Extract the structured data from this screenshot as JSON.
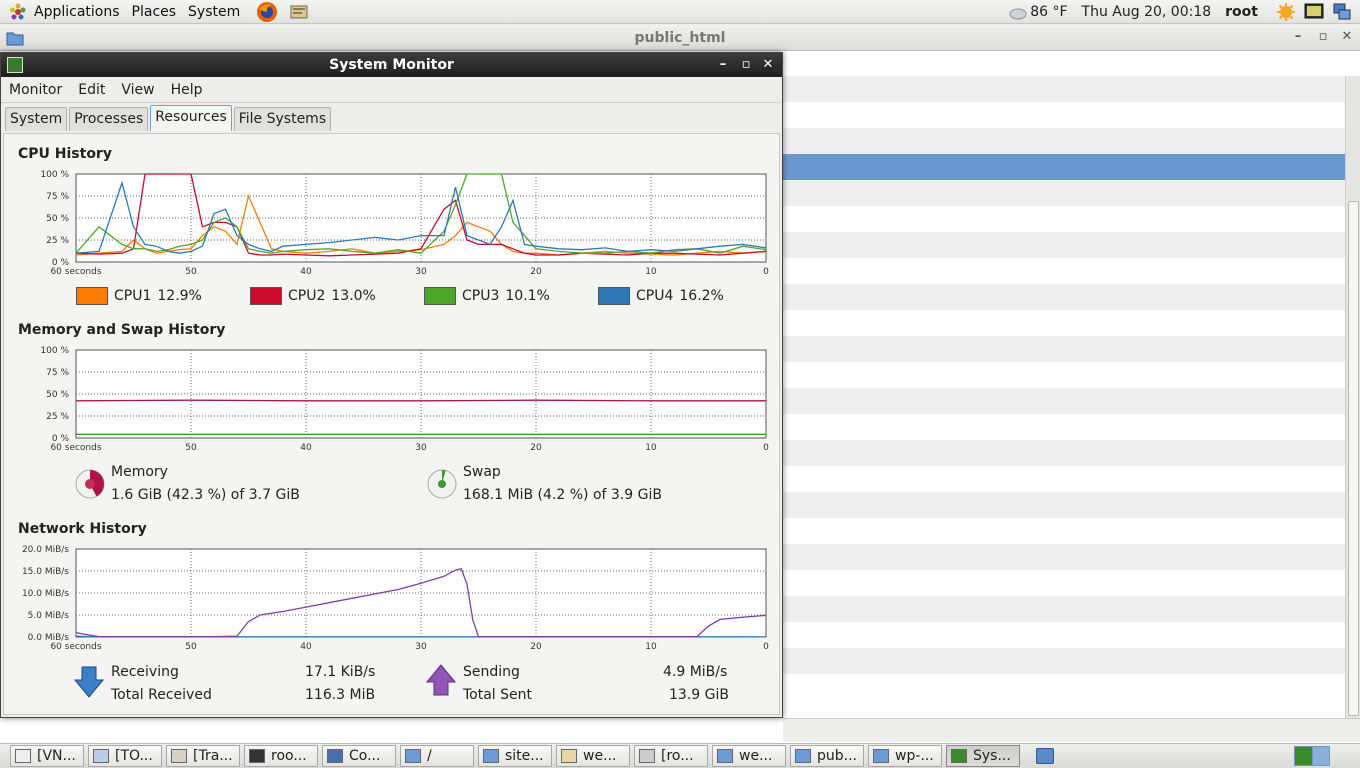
{
  "top_panel": {
    "menus": [
      "Applications",
      "Places",
      "System"
    ],
    "weather": "86 °F",
    "clock": "Thu Aug 20, 00:18",
    "user": "root"
  },
  "bg_window": {
    "title": "public_html",
    "ctrl_min": "–",
    "ctrl_max": "▫",
    "ctrl_close": "✕"
  },
  "sm_window": {
    "title": "System Monitor",
    "ctrl_min": "–",
    "ctrl_max": "▫",
    "ctrl_close": "✕",
    "menus": [
      "Monitor",
      "Edit",
      "View",
      "Help"
    ],
    "tabs": [
      "System",
      "Processes",
      "Resources",
      "File Systems"
    ],
    "active_tab": "Resources"
  },
  "cpu": {
    "title": "CPU History",
    "y_ticks": [
      "100 %",
      "75 %",
      "50 %",
      "25 %",
      "0 %"
    ],
    "x_ticks": [
      "60 seconds",
      "50",
      "40",
      "30",
      "20",
      "10",
      "0"
    ],
    "legend": [
      {
        "name": "CPU1",
        "value": "12.9%",
        "color": "#ff7b00"
      },
      {
        "name": "CPU2",
        "value": "13.0%",
        "color": "#cc0a2e"
      },
      {
        "name": "CPU3",
        "value": "10.1%",
        "color": "#4ea72a"
      },
      {
        "name": "CPU4",
        "value": "16.2%",
        "color": "#2f78b8"
      }
    ]
  },
  "memory": {
    "title": "Memory and Swap History",
    "y_ticks": [
      "100 %",
      "75 %",
      "50 %",
      "25 %",
      "0 %"
    ],
    "x_ticks": [
      "60 seconds",
      "50",
      "40",
      "30",
      "20",
      "10",
      "0"
    ],
    "memory_label": "Memory",
    "memory_value": "1.6 GiB (42.3 %) of 3.7 GiB",
    "memory_color": "#b0124a",
    "swap_label": "Swap",
    "swap_value": "168.1 MiB (4.2 %) of 3.9 GiB",
    "swap_color": "#3f9a2b"
  },
  "network": {
    "title": "Network History",
    "y_ticks": [
      "20.0 MiB/s",
      "15.0 MiB/s",
      "10.0 MiB/s",
      "5.0 MiB/s",
      "0.0 MiB/s"
    ],
    "x_ticks": [
      "60 seconds",
      "50",
      "40",
      "30",
      "20",
      "10",
      "0"
    ],
    "receiving_label": "Receiving",
    "receiving_value": "17.1 KiB/s",
    "total_received_label": "Total Received",
    "total_received_value": "116.3 MiB",
    "sending_label": "Sending",
    "sending_value": "4.9 MiB/s",
    "total_sent_label": "Total Sent",
    "total_sent_value": "13.9 GiB",
    "receive_color": "#2f78b8",
    "send_color": "#7d3fa6"
  },
  "chart_data": [
    {
      "type": "line",
      "title": "CPU History",
      "x": [
        60,
        58,
        56,
        55,
        54,
        53,
        52,
        51,
        50,
        49,
        48,
        47,
        46,
        45,
        44,
        43,
        42,
        40,
        38,
        36,
        34,
        32,
        30,
        28,
        27,
        26,
        25,
        24,
        23,
        22,
        21,
        20,
        18,
        16,
        14,
        12,
        10,
        8,
        6,
        4,
        2,
        0
      ],
      "ylim": [
        0,
        100
      ],
      "series": [
        {
          "name": "CPU1",
          "values": [
            8,
            10,
            12,
            25,
            15,
            10,
            12,
            14,
            15,
            30,
            40,
            35,
            20,
            75,
            45,
            15,
            12,
            10,
            12,
            15,
            10,
            12,
            14,
            20,
            30,
            45,
            40,
            35,
            20,
            12,
            10,
            10,
            8,
            10,
            12,
            10,
            9,
            8,
            10,
            12,
            10,
            12
          ]
        },
        {
          "name": "CPU2",
          "values": [
            10,
            9,
            10,
            15,
            100,
            100,
            100,
            100,
            100,
            40,
            45,
            45,
            40,
            10,
            8,
            8,
            9,
            8,
            7,
            8,
            9,
            10,
            15,
            60,
            70,
            25,
            20,
            20,
            20,
            15,
            10,
            8,
            8,
            10,
            9,
            8,
            10,
            10,
            9,
            8,
            10,
            12
          ]
        },
        {
          "name": "CPU3",
          "values": [
            10,
            40,
            20,
            15,
            15,
            12,
            14,
            18,
            20,
            25,
            45,
            50,
            40,
            15,
            12,
            10,
            12,
            14,
            15,
            12,
            10,
            14,
            10,
            35,
            65,
            100,
            100,
            100,
            100,
            45,
            30,
            15,
            12,
            10,
            10,
            12,
            10,
            14,
            15,
            10,
            18,
            14
          ]
        },
        {
          "name": "CPU4",
          "values": [
            10,
            12,
            90,
            40,
            20,
            18,
            12,
            10,
            12,
            18,
            55,
            60,
            30,
            20,
            15,
            12,
            18,
            20,
            22,
            25,
            28,
            25,
            30,
            30,
            85,
            30,
            25,
            20,
            40,
            70,
            20,
            18,
            15,
            14,
            16,
            12,
            14,
            12,
            15,
            18,
            20,
            16
          ]
        }
      ]
    },
    {
      "type": "line",
      "title": "Memory and Swap History",
      "x": [
        60,
        50,
        40,
        30,
        20,
        10,
        0
      ],
      "ylim": [
        0,
        100
      ],
      "series": [
        {
          "name": "Memory",
          "values": [
            42.3,
            43,
            42.3,
            42.3,
            43,
            42.3,
            42.3
          ]
        },
        {
          "name": "Swap",
          "values": [
            4.2,
            4.2,
            4.2,
            4.2,
            4.2,
            4.2,
            4.2
          ]
        }
      ]
    },
    {
      "type": "line",
      "title": "Network History",
      "x": [
        60,
        59,
        58,
        50,
        48,
        46,
        45,
        44,
        42,
        40,
        38,
        36,
        34,
        32,
        30,
        28,
        27,
        26.5,
        26,
        25.5,
        25,
        20,
        15,
        10,
        6,
        5,
        4,
        2,
        0
      ],
      "ylim": [
        0,
        20
      ],
      "series": [
        {
          "name": "Receiving",
          "values": [
            0.2,
            0.1,
            0.05,
            0.05,
            0.05,
            0.05,
            0.05,
            0.05,
            0.05,
            0.05,
            0.05,
            0.05,
            0.05,
            0.05,
            0.05,
            0.05,
            0.05,
            0.05,
            0.05,
            0.05,
            0.05,
            0.05,
            0.05,
            0.05,
            0.05,
            0.05,
            0.05,
            0.05,
            0.02
          ]
        },
        {
          "name": "Sending",
          "values": [
            1.0,
            0.5,
            0.1,
            0.1,
            0.1,
            0.2,
            3.5,
            5.0,
            5.8,
            6.8,
            7.8,
            8.8,
            9.8,
            10.8,
            12.2,
            13.8,
            15.2,
            15.5,
            12,
            4,
            0.1,
            0.1,
            0.1,
            0.1,
            0.1,
            2.5,
            4.0,
            4.5,
            4.9
          ]
        }
      ]
    }
  ],
  "taskbar": {
    "tasks": [
      {
        "label": "[VN...",
        "active": false
      },
      {
        "label": "[TO...",
        "active": false
      },
      {
        "label": "[Tra...",
        "active": false
      },
      {
        "label": "roo...",
        "active": false
      },
      {
        "label": "Co...",
        "active": false
      },
      {
        "label": "/",
        "active": false
      },
      {
        "label": "site...",
        "active": false
      },
      {
        "label": "we...",
        "active": false
      },
      {
        "label": "[ro...",
        "active": false
      },
      {
        "label": "we...",
        "active": false
      },
      {
        "label": "pub...",
        "active": false
      },
      {
        "label": "wp-...",
        "active": false
      },
      {
        "label": "Sys...",
        "active": true
      }
    ]
  }
}
